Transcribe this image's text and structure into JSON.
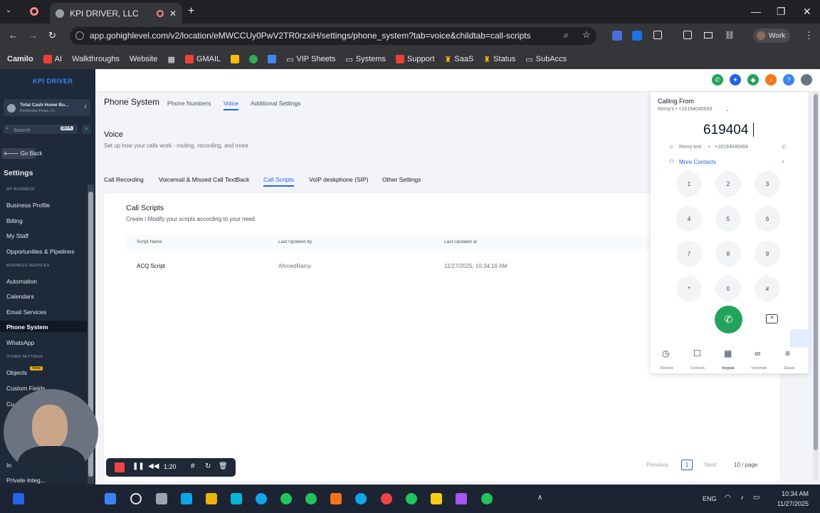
{
  "browser": {
    "tab_title": "KPI DRIVER, LLC",
    "url": "app.gohighlevel.com/v2/location/eMWCCUy0PwV2TR0rzxiH/settings/phone_system?tab=voice&childtab=call-scripts",
    "profile": "Work",
    "bookmarks": [
      "Camilo",
      "AI",
      "Walkthroughs",
      "Website",
      "GMAIL",
      "VIP Sheets",
      "Systems",
      "Support",
      "SaaS",
      "Status",
      "SubAccs"
    ]
  },
  "sidebar": {
    "logo": "KPI DRIVER",
    "account_name": "Total Cash Home Bu...",
    "account_location": "Pembroke Pines, FL",
    "search_placeholder": "Search",
    "search_shortcut": "ctrl K",
    "go_back": "Go Back",
    "heading": "Settings",
    "cat_business": "MY BUSINESS",
    "cat_services": "BUSINESS SERVICES",
    "cat_other": "OTHER SETTINGS",
    "items": {
      "business_profile": "Business Profile",
      "billing": "Billing",
      "my_staff": "My Staff",
      "opportunities": "Opportunities & Pipelines",
      "automation": "Automation",
      "calendars": "Calendars",
      "email_services": "Email Services",
      "phone_system": "Phone System",
      "whatsapp": "WhatsApp",
      "objects": "Objects",
      "objects_badge": "New",
      "custom_fields": "Custom Fields",
      "cu": "Cu",
      "in": "In",
      "private": "Private Integ..."
    }
  },
  "page": {
    "title": "Phone System",
    "top_tabs": [
      "Phone Numbers",
      "Voice",
      "Additional Settings"
    ],
    "section_title": "Voice",
    "section_sub": "Set up how your calls work - routing, recording, and more",
    "sub_tabs": [
      "Call Recording",
      "Voicemail & Missed Call TextBack",
      "Call Scripts",
      "VoIP deskphone (SIP)",
      "Other Settings"
    ],
    "card_title": "Call Scripts",
    "card_sub": "Create / Modify your scripts according to your need",
    "columns": [
      "Script Name",
      "Last Updated by",
      "Last Updated at"
    ],
    "rows": [
      {
        "name": "ACQ Script",
        "by": "AhmedRamy",
        "at": "11/27/2025, 10:34:16 AM"
      }
    ],
    "pagination": {
      "prev": "Previous",
      "page": "1",
      "next": "Next",
      "per_page": "10 / page"
    }
  },
  "dialer": {
    "calling_from_label": "Calling From",
    "calling_from_number": "Remy's • +16194046699",
    "entered_number": "619404",
    "suggestion_name": "Remy test",
    "suggestion_number": "+16194040464",
    "more_contacts": "More Contacts",
    "keys": [
      "1",
      "2",
      "3",
      "4",
      "5",
      "6",
      "7",
      "8",
      "9",
      "*",
      "0",
      "#"
    ],
    "tabs": [
      "Recents",
      "Contacts",
      "Keypad",
      "Voicemail",
      "Queue"
    ]
  },
  "recorder": {
    "time": "1:20"
  },
  "taskbar": {
    "language": "ENG",
    "time": "10:34 AM",
    "date": "11/27/2025"
  },
  "colors": {
    "accent": "#2563eb",
    "call_green": "#22a35a",
    "sidebar": "#1e2a3a"
  }
}
